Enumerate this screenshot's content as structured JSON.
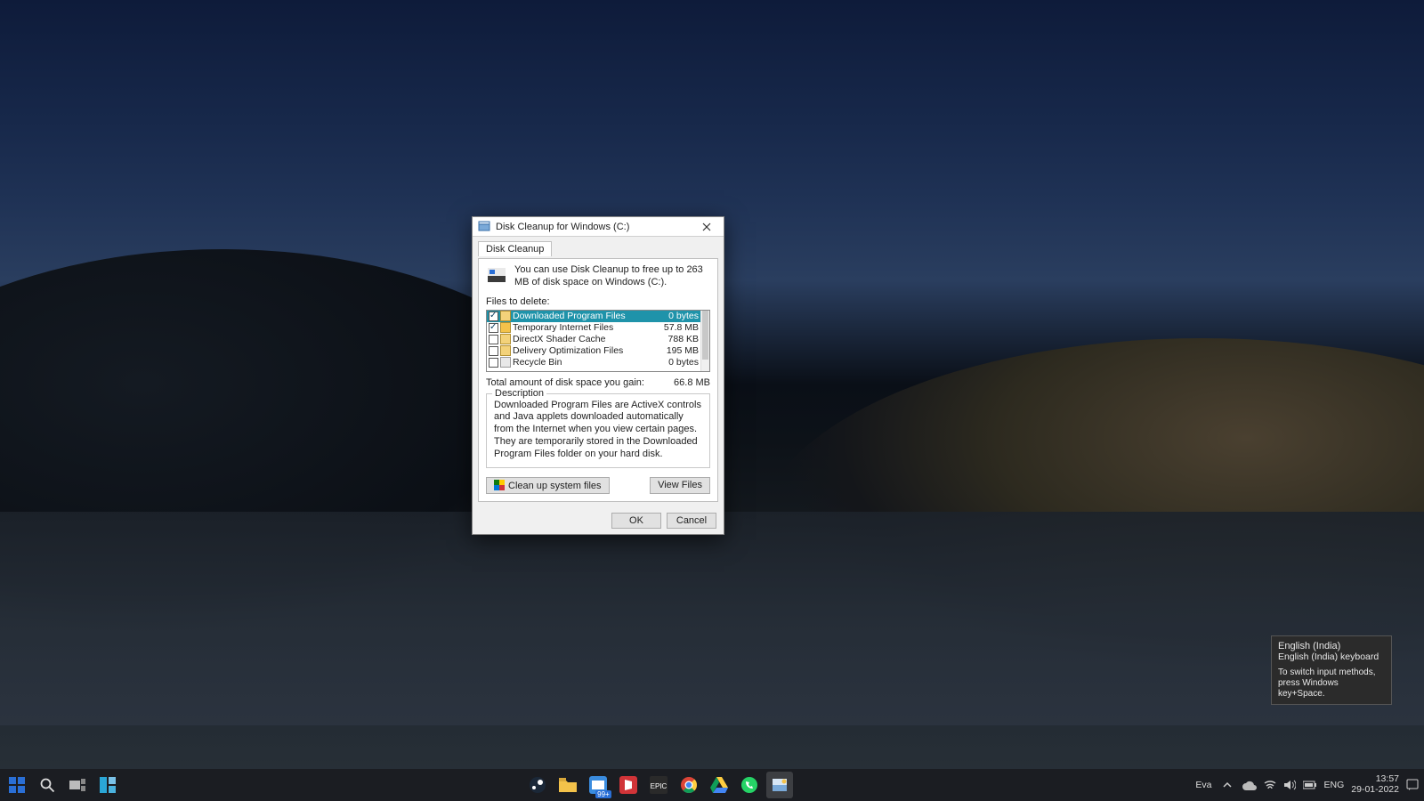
{
  "dialog": {
    "title": "Disk Cleanup for Windows (C:)",
    "tab": "Disk Cleanup",
    "intro": "You can use Disk Cleanup to free up to 263 MB of disk space on Windows (C:).",
    "files_label": "Files to delete:",
    "items": [
      {
        "name": "Downloaded Program Files",
        "size": "0 bytes",
        "checked": true,
        "selected": true,
        "icon": "folder"
      },
      {
        "name": "Temporary Internet Files",
        "size": "57.8 MB",
        "checked": true,
        "selected": false,
        "icon": "lock"
      },
      {
        "name": "DirectX Shader Cache",
        "size": "788 KB",
        "checked": false,
        "selected": false,
        "icon": "folder"
      },
      {
        "name": "Delivery Optimization Files",
        "size": "195 MB",
        "checked": false,
        "selected": false,
        "icon": "folder"
      },
      {
        "name": "Recycle Bin",
        "size": "0 bytes",
        "checked": false,
        "selected": false,
        "icon": "bin"
      }
    ],
    "total_label": "Total amount of disk space you gain:",
    "total_value": "66.8 MB",
    "desc_legend": "Description",
    "desc_text": "Downloaded Program Files are ActiveX controls and Java applets downloaded automatically from the Internet when you view certain pages. They are temporarily stored in the Downloaded Program Files folder on your hard disk.",
    "clean_system": "Clean up system files",
    "view_files": "View Files",
    "ok": "OK",
    "cancel": "Cancel"
  },
  "tooltip": {
    "title": "English (India)",
    "subtitle": "English (India) keyboard",
    "hint": "To switch input methods, press Windows key+Space."
  },
  "tray": {
    "eval": "Eva",
    "lang": "ENG",
    "time": "13:57",
    "date": "29-01-2022",
    "notif_badge": "99+"
  }
}
